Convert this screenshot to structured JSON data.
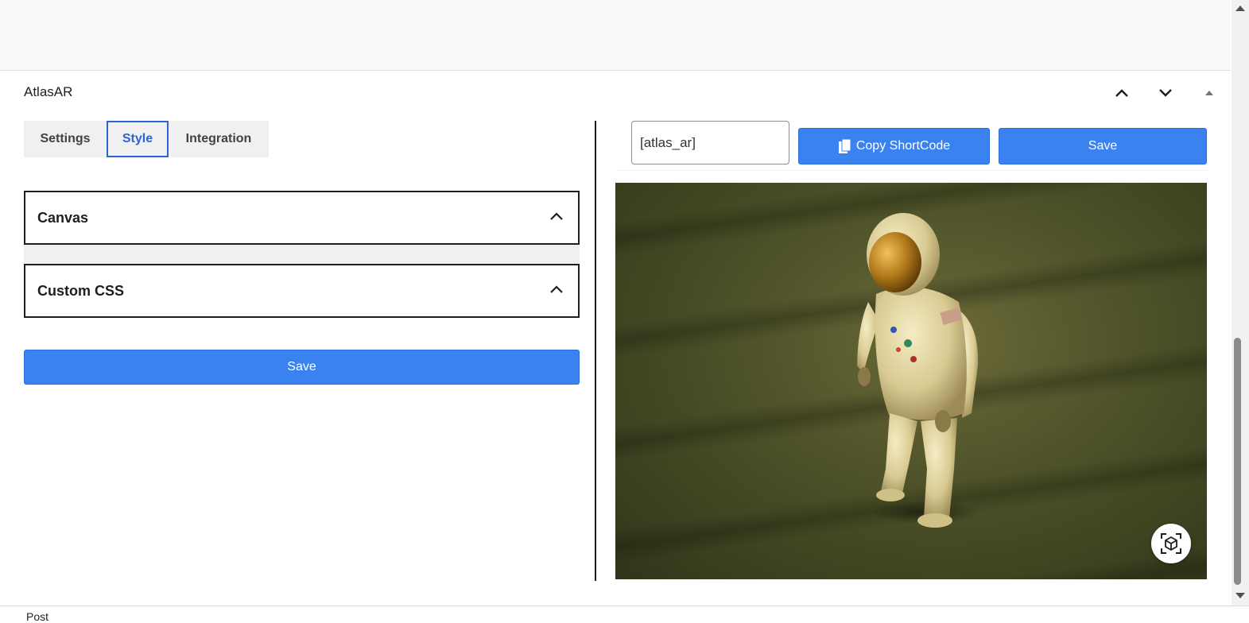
{
  "panel": {
    "title": "AtlasAR"
  },
  "tabs": [
    {
      "label": "Settings",
      "active": false
    },
    {
      "label": "Style",
      "active": true
    },
    {
      "label": "Integration",
      "active": false
    }
  ],
  "accordions": [
    {
      "label": "Canvas",
      "icon": "chevron-up-icon"
    },
    {
      "label": "Custom CSS",
      "icon": "chevron-up-icon"
    }
  ],
  "left": {
    "save_label": "Save"
  },
  "shortcode": {
    "value": "[atlas_ar]"
  },
  "right": {
    "copy_label": "Copy ShortCode",
    "copy_icon": "copy-icon",
    "save_label": "Save"
  },
  "viewer": {
    "ar_icon": "ar-cube-icon"
  },
  "header_controls": [
    "chevron-up-icon",
    "chevron-down-icon",
    "caret-up-icon"
  ],
  "footer": {
    "label": "Post"
  },
  "colors": {
    "accent": "#3a82f0",
    "tab_active": "#2c64d4",
    "border": "#1e1e1e"
  }
}
